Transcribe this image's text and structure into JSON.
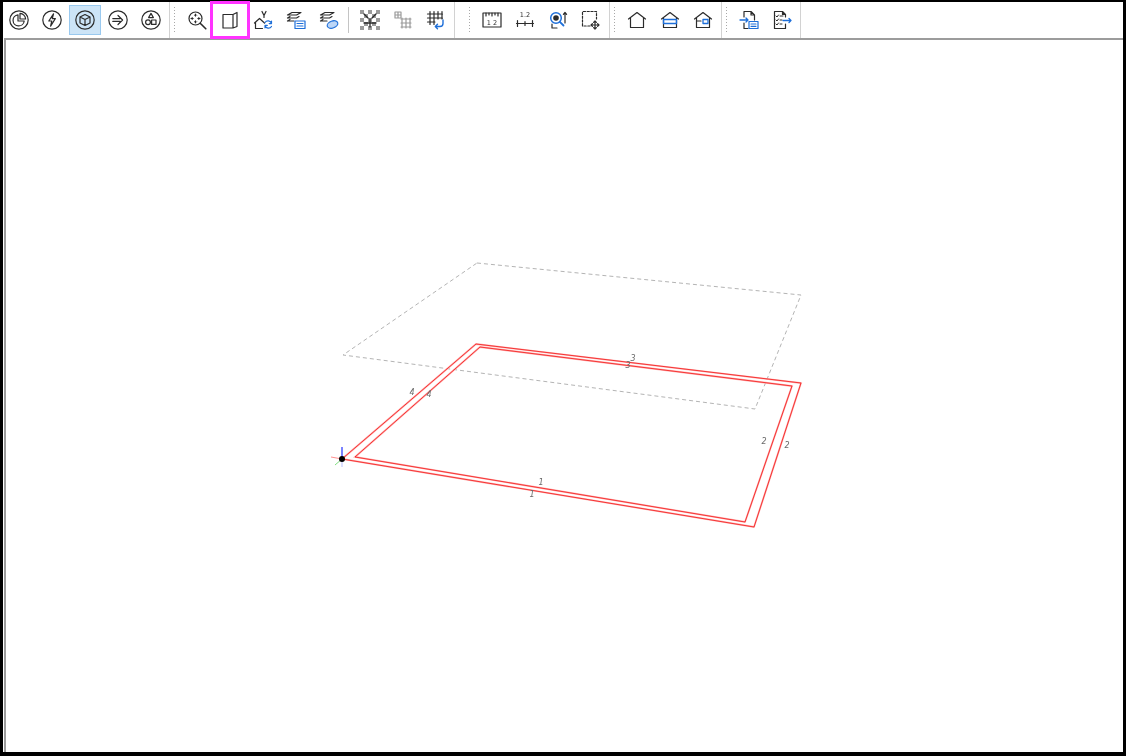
{
  "toolbar": {
    "strips": [
      {
        "items": [
          {
            "kind": "button",
            "selected": false,
            "highlighted": false
          },
          {
            "kind": "button",
            "selected": false,
            "highlighted": false
          },
          {
            "kind": "button",
            "selected": true,
            "highlighted": false
          },
          {
            "kind": "button",
            "selected": false,
            "highlighted": false
          },
          {
            "kind": "button",
            "selected": false,
            "highlighted": false
          }
        ]
      },
      {
        "items": [
          {
            "kind": "button",
            "selected": false,
            "highlighted": false
          },
          {
            "kind": "button",
            "selected": false,
            "highlighted": true
          },
          {
            "kind": "button",
            "selected": false,
            "highlighted": false
          },
          {
            "kind": "button",
            "selected": false,
            "highlighted": false
          },
          {
            "kind": "button",
            "selected": false,
            "highlighted": false
          },
          {
            "kind": "separator"
          },
          {
            "kind": "button",
            "selected": false,
            "highlighted": false
          },
          {
            "kind": "button",
            "selected": false,
            "highlighted": false
          },
          {
            "kind": "button",
            "selected": false,
            "highlighted": false
          }
        ]
      },
      {
        "items": [
          {
            "kind": "button",
            "selected": false,
            "highlighted": false,
            "glyph": "1 2"
          },
          {
            "kind": "button",
            "selected": false,
            "highlighted": false,
            "glyph": "1.2"
          },
          {
            "kind": "button",
            "selected": false,
            "highlighted": false
          },
          {
            "kind": "button",
            "selected": false,
            "highlighted": false
          }
        ]
      },
      {
        "items": [
          {
            "kind": "button",
            "selected": false,
            "highlighted": false
          },
          {
            "kind": "button",
            "selected": false,
            "highlighted": false
          },
          {
            "kind": "button",
            "selected": false,
            "highlighted": false
          }
        ]
      },
      {
        "items": [
          {
            "kind": "button",
            "selected": false,
            "highlighted": false
          },
          {
            "kind": "button",
            "selected": false,
            "highlighted": false
          }
        ]
      }
    ]
  },
  "viewport": {
    "edge_labels": [
      "3",
      "3",
      "4",
      "4",
      "2",
      "2",
      "1",
      "1"
    ]
  }
}
